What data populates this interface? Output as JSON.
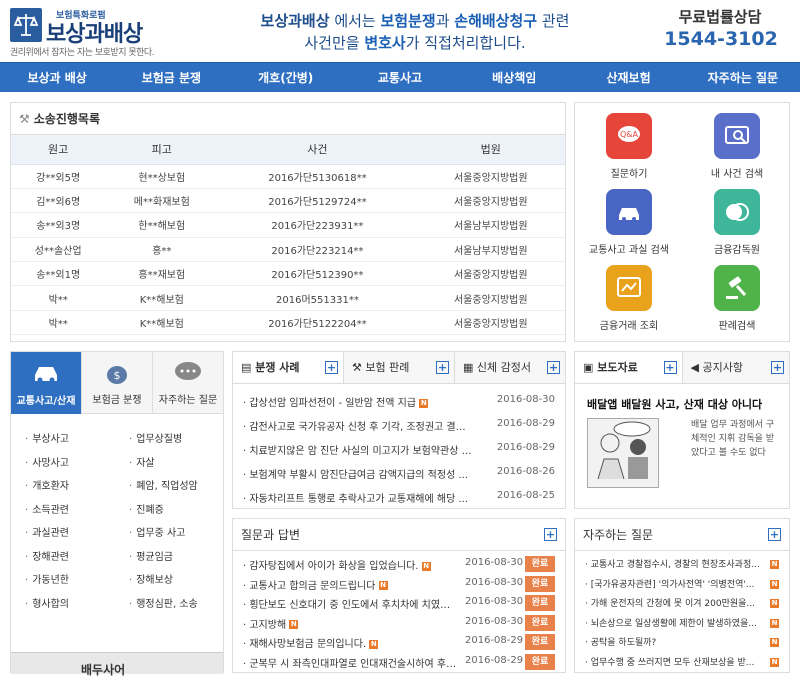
{
  "header": {
    "logo_sub": "보험특화로펌",
    "logo_main": "보상과배상",
    "logo_tag": "권리위에서 잠자는 자는 보호받지 못한다.",
    "slogan_a": "보상과배상",
    "slogan_b": " 에서는 ",
    "slogan_c": "보험분쟁",
    "slogan_d": "과 ",
    "slogan_e": "손해배상청구",
    "slogan_f": " 관련",
    "slogan_2a": "사건만을 ",
    "slogan_2b": "변호사",
    "slogan_2c": "가 직접처리합니다.",
    "hotline_label": "무료법률상담",
    "hotline_number": "1544-3102"
  },
  "nav": [
    "보상과 배상",
    "보험금 분쟁",
    "개호(간병)",
    "교통사고",
    "배상책임",
    "산재보험",
    "자주하는 질문"
  ],
  "litigation": {
    "title": "소송진행목록",
    "columns": [
      "원고",
      "피고",
      "사건",
      "법원"
    ],
    "rows": [
      [
        "강**외5명",
        "현**상보험",
        "2016가단5130618**",
        "서울중앙지방법원"
      ],
      [
        "김**외6명",
        "메**화재보험",
        "2016가단5129724**",
        "서울중앙지방법원"
      ],
      [
        "송**외3명",
        "한**해보험",
        "2016가단223931**",
        "서울남부지방법원"
      ],
      [
        "성**솔산업",
        "홍**",
        "2016가단223214**",
        "서울남부지방법원"
      ],
      [
        "송**외1명",
        "흥**재보험",
        "2016가단512390**",
        "서울중앙지방법원"
      ],
      [
        "박**",
        "K**해보험",
        "2016머551331**",
        "서울중앙지방법원"
      ],
      [
        "박**",
        "K**해보험",
        "2016가단5122204**",
        "서울중앙지방법원"
      ]
    ]
  },
  "services": [
    {
      "label": "질문하기",
      "color": "#e6453a"
    },
    {
      "label": "내 사건 검색",
      "color": "#5a6fc9"
    },
    {
      "label": "교통사고 과실 검색",
      "color": "#4a66c4"
    },
    {
      "label": "금융감독원",
      "color": "#3fb59a"
    },
    {
      "label": "금융거래 조회",
      "color": "#e9a21c"
    },
    {
      "label": "판례검색",
      "color": "#4fb34a"
    }
  ],
  "categories": {
    "tabs": [
      "교통사고/산재",
      "보험금 분쟁",
      "자주하는 질문"
    ],
    "items": [
      "부상사고",
      "업무상질병",
      "사망사고",
      "자살",
      "개호환자",
      "폐암, 직업성암",
      "소득관련",
      "진폐증",
      "과실관련",
      "업무중 사고",
      "장해관련",
      "평균임금",
      "가동년한",
      "장해보상",
      "형사합의",
      "행정심판, 소송"
    ],
    "banner_text": "배두사어"
  },
  "disputes": {
    "tabs": [
      "분쟁 사례",
      "보험 판례",
      "신체 감정서"
    ],
    "rows": [
      {
        "title": "갑상선암 임파선전이 - 일반암 전액 지급",
        "new": "N",
        "date": "2016-08-30"
      },
      {
        "title": "감전사고로 국가유공자 신청 후 기각, 조정권고 결정",
        "new": "N",
        "date": "2016-08-29"
      },
      {
        "title": "치료받지않은 암 진단 사실의 미고지가 보험약관상 ...",
        "new": "N",
        "date": "2016-08-29"
      },
      {
        "title": "보험계약 부활시 암진단급여금 감액지급의 적정성 ...",
        "new": "",
        "date": "2016-08-26"
      },
      {
        "title": "자동차리프트 통행로 추락사고가 교통재해에 해당 ...",
        "new": "",
        "date": "2016-08-25"
      }
    ]
  },
  "press": {
    "tabs": [
      "보도자료",
      "공지사항"
    ],
    "headline": "배달앱 배달원 사고, 산재 대상 아니다",
    "summary": "배달 업무 과정에서 구체적인 지휘 감독을 받았다고 볼 수도 없다"
  },
  "qa": {
    "title": "질문과 답변",
    "rows": [
      {
        "title": "감자탕집에서 아이가 화상을 입었습니다.",
        "new": "N",
        "date": "2016-08-30",
        "status": "완료"
      },
      {
        "title": "교통사고 합의금 문의드립니다",
        "new": "N",
        "date": "2016-08-30",
        "status": "완료"
      },
      {
        "title": "횡단보도 신호대기 중 인도에서 후치차에 치였습...",
        "new": "N",
        "date": "2016-08-30",
        "status": "완료"
      },
      {
        "title": "고지방해",
        "new": "N",
        "date": "2016-08-30",
        "status": "완료"
      },
      {
        "title": "재해사망보험금 문의입니다.",
        "new": "N",
        "date": "2016-08-29",
        "status": "완료"
      },
      {
        "title": "군복무 시 좌측인대파열로 인대재건술시하여 후 ...",
        "new": "N",
        "date": "2016-08-29",
        "status": "완료"
      }
    ]
  },
  "faq": {
    "title": "자주하는 질문",
    "rows": [
      {
        "title": "교통사고 경찰접수시, 경찰의 현장조사과정...",
        "new": "N"
      },
      {
        "title": "[국가유공자관련] '의가사전역' '의병전역'...",
        "new": "N"
      },
      {
        "title": "가해 운전자의 간청에 못 이겨 200만원을...",
        "new": "N"
      },
      {
        "title": "뇌손상으로 일상생활에 제한이 발생하였을...",
        "new": "N"
      },
      {
        "title": "공탁을 하도될까?",
        "new": "N"
      },
      {
        "title": "업무수행 중 쓰러지면 모두 산재보상을 받...",
        "new": "N"
      }
    ]
  }
}
